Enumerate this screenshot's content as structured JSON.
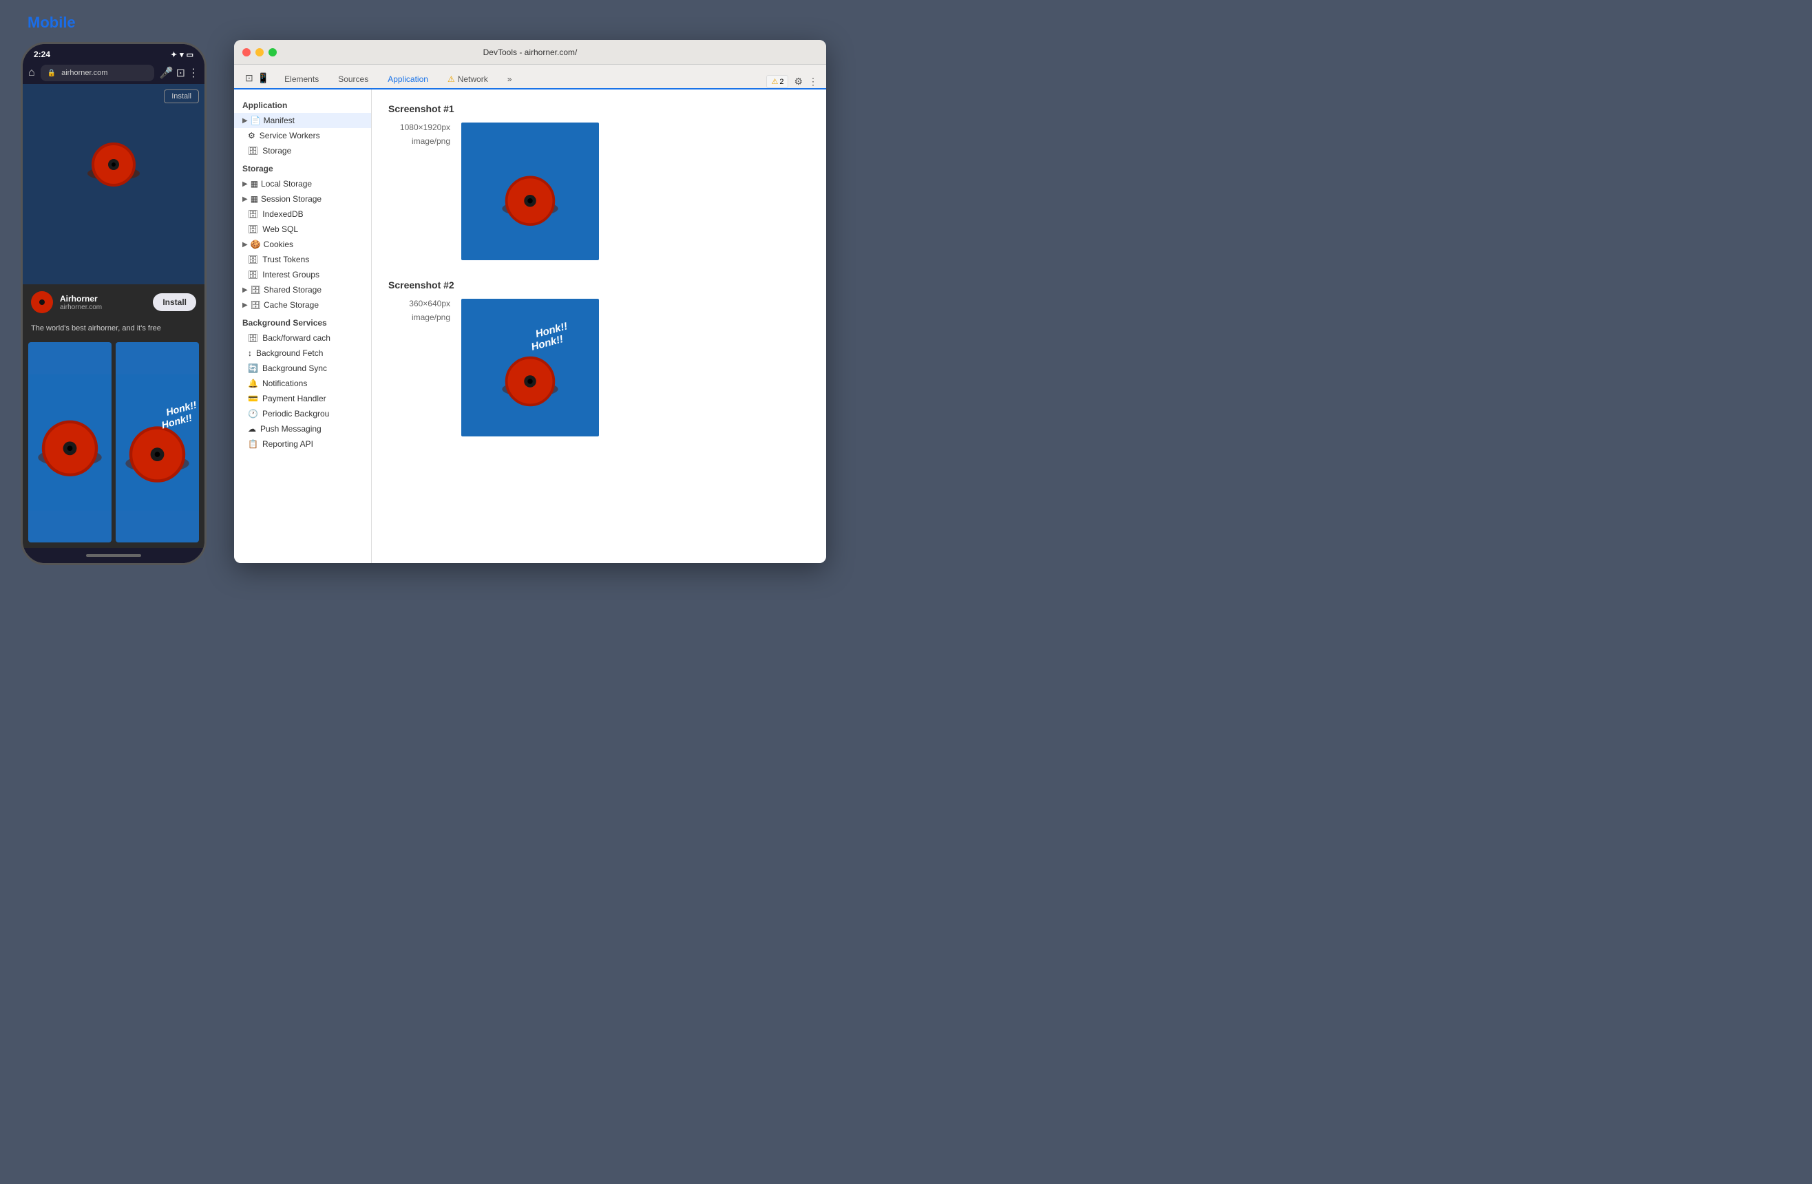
{
  "mobile": {
    "label": "Mobile",
    "time": "2:24",
    "url": "airhorner.com",
    "install_top": "Install",
    "app_name": "Airhorner",
    "app_url": "airhorner.com",
    "install_banner_btn": "Install",
    "description": "The world's best airhorner, and it's free"
  },
  "devtools": {
    "title": "DevTools - airhorner.com/",
    "tabs": [
      {
        "label": "Elements",
        "active": false
      },
      {
        "label": "Sources",
        "active": false
      },
      {
        "label": "Application",
        "active": true
      },
      {
        "label": "⚠ Network",
        "active": false
      }
    ],
    "warning_count": "2",
    "sidebar": {
      "sections": [
        {
          "label": "Application",
          "items": [
            {
              "label": "Manifest",
              "icon": "📄",
              "expandable": true,
              "active": true
            },
            {
              "label": "Service Workers",
              "icon": "⚙️",
              "expandable": false
            },
            {
              "label": "Storage",
              "icon": "🗄️",
              "expandable": false
            }
          ]
        },
        {
          "label": "Storage",
          "items": [
            {
              "label": "Local Storage",
              "icon": "▦",
              "expandable": true
            },
            {
              "label": "Session Storage",
              "icon": "▦",
              "expandable": true
            },
            {
              "label": "IndexedDB",
              "icon": "🗄️",
              "expandable": false
            },
            {
              "label": "Web SQL",
              "icon": "🗄️",
              "expandable": false
            },
            {
              "label": "Cookies",
              "icon": "🍪",
              "expandable": true
            },
            {
              "label": "Trust Tokens",
              "icon": "🗄️",
              "expandable": false
            },
            {
              "label": "Interest Groups",
              "icon": "🗄️",
              "expandable": false
            },
            {
              "label": "Shared Storage",
              "icon": "🗄️",
              "expandable": true
            },
            {
              "label": "Cache Storage",
              "icon": "🗄️",
              "expandable": true
            }
          ]
        },
        {
          "label": "Background Services",
          "items": [
            {
              "label": "Back/forward cach",
              "icon": "🗄️",
              "expandable": false
            },
            {
              "label": "Background Fetch",
              "icon": "↕",
              "expandable": false
            },
            {
              "label": "Background Sync",
              "icon": "🔄",
              "expandable": false
            },
            {
              "label": "Notifications",
              "icon": "🔔",
              "expandable": false
            },
            {
              "label": "Payment Handler",
              "icon": "💳",
              "expandable": false
            },
            {
              "label": "Periodic Backgrou",
              "icon": "🕐",
              "expandable": false
            },
            {
              "label": "Push Messaging",
              "icon": "☁️",
              "expandable": false
            },
            {
              "label": "Reporting API",
              "icon": "📋",
              "expandable": false
            }
          ]
        }
      ]
    },
    "main": {
      "screenshot1": {
        "title": "Screenshot #1",
        "dims": "1080×1920px",
        "type": "image/png"
      },
      "screenshot2": {
        "title": "Screenshot #2",
        "dims": "360×640px",
        "type": "image/png"
      }
    }
  }
}
